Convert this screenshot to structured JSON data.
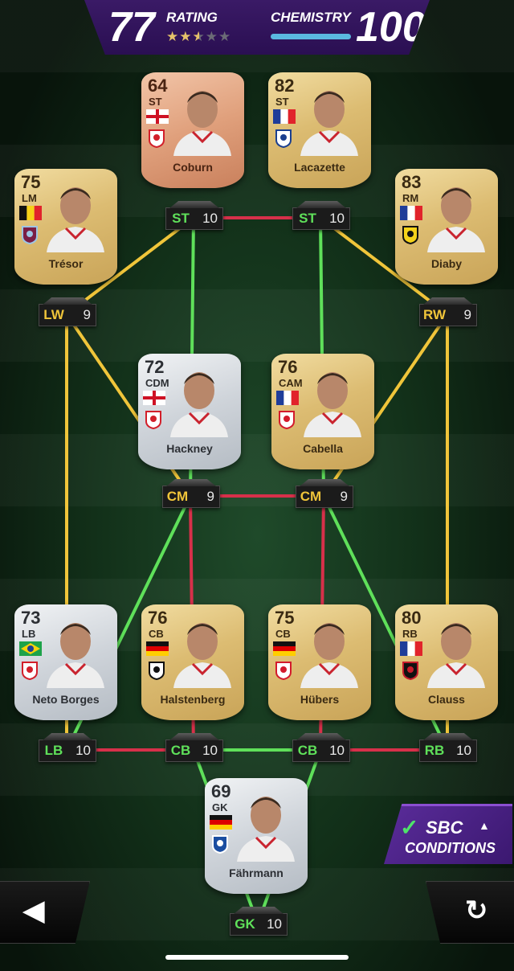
{
  "header": {
    "rating_value": "77",
    "rating_label": "RATING",
    "rating_stars": 2.5,
    "rating_stars_max": 5,
    "chemistry_label": "CHEMISTRY",
    "chemistry_value": "100",
    "chemistry_fill": 1.0
  },
  "colors": {
    "link_green": "#5fe05a",
    "link_yellow": "#f0c53a",
    "link_red": "#d7304a",
    "header_purple": "#2a0f52",
    "chem_bar": "#5ab9e0"
  },
  "players": [
    {
      "id": "coburn",
      "name": "Coburn",
      "rating": "64",
      "pos": "ST",
      "tier": "bronze",
      "flag": "england",
      "club": "middlesbrough",
      "slot": "ST",
      "chem": "10",
      "chem_color": "g"
    },
    {
      "id": "lacazette",
      "name": "Lacazette",
      "rating": "82",
      "pos": "ST",
      "tier": "gold",
      "flag": "france",
      "club": "lyon",
      "slot": "ST",
      "chem": "10",
      "chem_color": "g"
    },
    {
      "id": "tresor",
      "name": "Trésor",
      "rating": "75",
      "pos": "LM",
      "tier": "gold",
      "flag": "belgium",
      "club": "burnley",
      "slot": "LW",
      "chem": "9",
      "chem_color": "y"
    },
    {
      "id": "diaby",
      "name": "Diaby",
      "rating": "83",
      "pos": "RM",
      "tier": "gold",
      "flag": "france",
      "club": "alittihad",
      "slot": "RW",
      "chem": "9",
      "chem_color": "y"
    },
    {
      "id": "hackney",
      "name": "Hackney",
      "rating": "72",
      "pos": "CDM",
      "tier": "silver",
      "flag": "england",
      "club": "middlesbrough",
      "slot": "CM",
      "chem": "9",
      "chem_color": "y"
    },
    {
      "id": "cabella",
      "name": "Cabella",
      "rating": "76",
      "pos": "CAM",
      "tier": "gold",
      "flag": "france",
      "club": "lille",
      "slot": "CM",
      "chem": "9",
      "chem_color": "y"
    },
    {
      "id": "netoborges",
      "name": "Neto Borges",
      "rating": "73",
      "pos": "LB",
      "tier": "silver",
      "flag": "brazil",
      "club": "middlesbrough",
      "slot": "LB",
      "chem": "10",
      "chem_color": "g"
    },
    {
      "id": "halstenberg",
      "name": "Halstenberg",
      "rating": "76",
      "pos": "CB",
      "tier": "gold",
      "flag": "germany",
      "club": "hannover",
      "slot": "CB",
      "chem": "10",
      "chem_color": "g"
    },
    {
      "id": "hubers",
      "name": "Hübers",
      "rating": "75",
      "pos": "CB",
      "tier": "gold",
      "flag": "germany",
      "club": "koln",
      "slot": "CB",
      "chem": "10",
      "chem_color": "g"
    },
    {
      "id": "clauss",
      "name": "Clauss",
      "rating": "80",
      "pos": "RB",
      "tier": "gold",
      "flag": "france",
      "club": "nice",
      "slot": "RB",
      "chem": "10",
      "chem_color": "g"
    },
    {
      "id": "fahrmann",
      "name": "Fährmann",
      "rating": "69",
      "pos": "GK",
      "tier": "silver",
      "flag": "germany",
      "club": "schalke",
      "slot": "GK",
      "chem": "10",
      "chem_color": "g"
    }
  ],
  "sbc": {
    "line1": "SBC",
    "line2": "CONDITIONS",
    "check_icon": "check-icon",
    "expand_icon": "chevron-up-icon"
  },
  "nav": {
    "back_icon": "back-arrow-icon",
    "reset_icon": "reset-icon"
  }
}
